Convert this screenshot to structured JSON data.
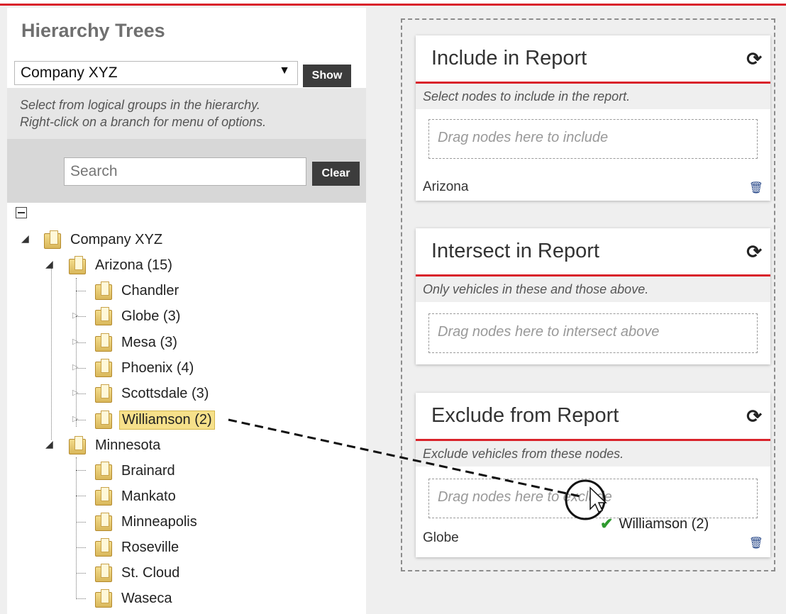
{
  "left": {
    "title": "Hierarchy Trees",
    "select_value": "Company XYZ",
    "show_label": "Show",
    "instructions": [
      "Select from logical groups in the hierarchy.",
      "Right-click on a branch for menu of options."
    ],
    "search_placeholder": "Search",
    "clear_label": "Clear"
  },
  "tree": {
    "root": "Company XYZ",
    "arizona": "Arizona (15)",
    "arizona_children": [
      "Chandler",
      "Globe (3)",
      "Mesa (3)",
      "Phoenix (4)",
      "Scottsdale (3)",
      "Williamson (2)"
    ],
    "minnesota": "Minnesota",
    "minnesota_children": [
      "Brainard",
      "Mankato",
      "Minneapolis",
      "Roseville",
      "St. Cloud",
      "Waseca"
    ]
  },
  "cards": {
    "include": {
      "title": "Include in Report",
      "subtitle": "Select nodes to include in the report.",
      "drop": "Drag nodes here to include",
      "item": "Arizona"
    },
    "intersect": {
      "title": "Intersect in Report",
      "subtitle": "Only vehicles in these and those above.",
      "drop": "Drag nodes here to intersect above"
    },
    "exclude": {
      "title": "Exclude from Report",
      "subtitle": "Exclude vehicles from these nodes.",
      "drop": "Drag nodes here to exclude",
      "item": "Globe"
    }
  },
  "drag": {
    "label": "Williamson (2)",
    "check_color": "#2e9a2e"
  },
  "icons": {
    "refresh": "refresh-icon",
    "trash": "trash-icon",
    "folder": "folder-icon",
    "cursor": "pointer-cursor-icon"
  },
  "colors": {
    "accent": "#d9232b",
    "button": "#3c3c3c"
  }
}
